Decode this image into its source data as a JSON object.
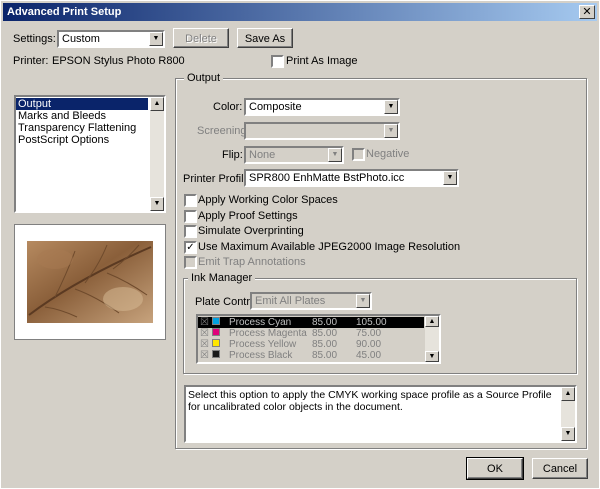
{
  "window": {
    "title": "Advanced Print Setup",
    "close_glyph": "✕"
  },
  "settings": {
    "label": "Settings:",
    "value": "Custom",
    "delete_label": "Delete",
    "save_as_label": "Save As"
  },
  "printer": {
    "label": "Printer:",
    "value": "EPSON Stylus Photo R800",
    "print_as_image_label": "Print As Image",
    "print_as_image_checked": false
  },
  "sidebar": {
    "items": [
      {
        "label": "Output",
        "selected": true
      },
      {
        "label": "Marks and Bleeds",
        "selected": false
      },
      {
        "label": "Transparency Flattening",
        "selected": false
      },
      {
        "label": "PostScript Options",
        "selected": false
      }
    ]
  },
  "output": {
    "group_title": "Output",
    "color_label": "Color:",
    "color_value": "Composite",
    "screening_label": "Screening:",
    "screening_value": "",
    "flip_label": "Flip:",
    "flip_value": "None",
    "negative_label": "Negative",
    "printer_profile_label": "Printer Profile:",
    "printer_profile_value": "SPR800 EnhMatte BstPhoto.icc",
    "options": [
      {
        "label": "Apply Working Color Spaces",
        "checked": false,
        "enabled": true
      },
      {
        "label": "Apply Proof Settings",
        "checked": false,
        "enabled": true
      },
      {
        "label": "Simulate Overprinting",
        "checked": false,
        "enabled": true
      },
      {
        "label": "Use Maximum Available JPEG2000 Image Resolution",
        "checked": true,
        "enabled": true
      },
      {
        "label": "Emit Trap Annotations",
        "checked": false,
        "enabled": false
      }
    ]
  },
  "ink_manager": {
    "group_title": "Ink Manager",
    "plate_control_label": "Plate Control",
    "plate_control_value": "Emit All Plates",
    "inks": [
      {
        "name": "Process Cyan",
        "frequency": "85.00",
        "angle": "105.00",
        "color": "#00a0e0",
        "selected": true
      },
      {
        "name": "Process Magenta",
        "frequency": "85.00",
        "angle": "75.00",
        "color": "#e0007a",
        "selected": false
      },
      {
        "name": "Process Yellow",
        "frequency": "85.00",
        "angle": "90.00",
        "color": "#ffe600",
        "selected": false
      },
      {
        "name": "Process Black",
        "frequency": "85.00",
        "angle": "45.00",
        "color": "#1a1a1a",
        "selected": false
      }
    ]
  },
  "description": "Select this option to apply the CMYK working space profile as a Source Profile for uncalibrated color objects in the document.",
  "footer": {
    "ok_label": "OK",
    "cancel_label": "Cancel"
  },
  "icons": {
    "dropdown_arrow": "▼",
    "scroll_up": "▲",
    "scroll_down": "▼",
    "check_mark": "✓"
  }
}
